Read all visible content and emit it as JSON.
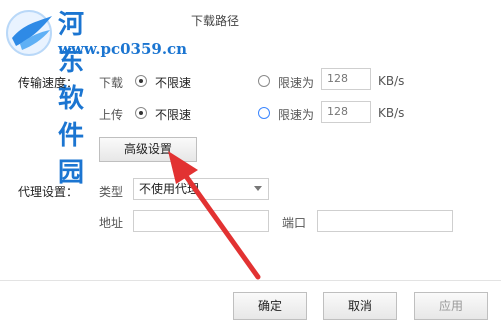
{
  "watermark": {
    "brand": "河东软件园",
    "url": "www.pc0359.cn"
  },
  "top_option": {
    "label": "下载路径"
  },
  "speed": {
    "label": "传输速度：",
    "download": {
      "label": "下载",
      "unlimited_label": "不限速",
      "limit_label": "限速为",
      "limit_value": "128",
      "unit": "KB/s"
    },
    "upload": {
      "label": "上传",
      "unlimited_label": "不限速",
      "limit_label": "限速为",
      "limit_value": "128",
      "unit": "KB/s"
    }
  },
  "advanced_button": "高级设置",
  "proxy": {
    "label": "代理设置：",
    "type_label": "类型",
    "type_value": "不使用代理",
    "address_label": "地址",
    "port_label": "端口"
  },
  "footer": {
    "ok": "确定",
    "cancel": "取消",
    "apply": "应用"
  },
  "colors": {
    "arrow": "#e23232",
    "accent": "#3b86ff",
    "watermark": "#1b75d1"
  }
}
